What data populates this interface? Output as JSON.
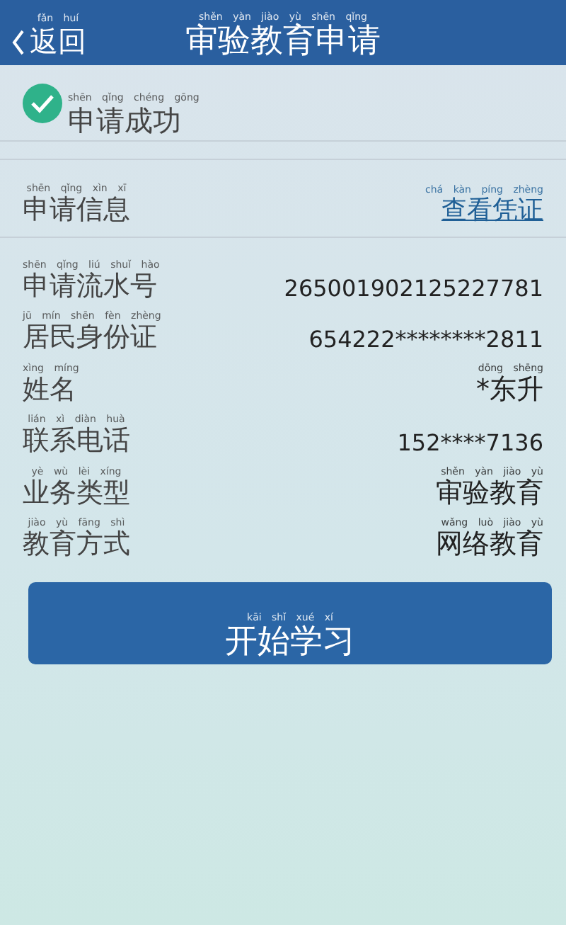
{
  "header": {
    "back": {
      "text": "返回",
      "pinyin": "fǎn huí"
    },
    "title": {
      "text": "审验教育申请",
      "pinyin": "shěn yàn jiào yù shēn qǐng"
    }
  },
  "status": {
    "text": "申请成功",
    "pinyin": "shēn qǐng chéng gōng",
    "success": true
  },
  "section": {
    "title": {
      "text": "申请信息",
      "pinyin": "shēn qǐng xìn xī"
    },
    "link": {
      "text": "查看凭证",
      "pinyin": "chá kàn píng zhèng"
    }
  },
  "rows": [
    {
      "label": {
        "text": "申请流水号",
        "pinyin": "shēn qǐng liú shuǐ hào"
      },
      "value": {
        "text": "265001902125227781"
      }
    },
    {
      "label": {
        "text": "居民身份证",
        "pinyin": "jū mín shēn fèn zhèng"
      },
      "value": {
        "text": "654222********2811"
      }
    },
    {
      "label": {
        "text": "姓名",
        "pinyin": "xìng míng"
      },
      "value": {
        "text": "*东升",
        "pinyin": "dōng shēng"
      }
    },
    {
      "label": {
        "text": "联系电话",
        "pinyin": "lián xì diàn huà"
      },
      "value": {
        "text": "152****7136"
      }
    },
    {
      "label": {
        "text": "业务类型",
        "pinyin": "yè wù lèi xíng"
      },
      "value": {
        "text": "审验教育",
        "pinyin": "shěn yàn jiào yù"
      }
    },
    {
      "label": {
        "text": "教育方式",
        "pinyin": "jiào yù fāng shì"
      },
      "value": {
        "text": "网络教育",
        "pinyin": "wǎng luò jiào yù"
      }
    }
  ],
  "button": {
    "text": "开始学习",
    "pinyin": "kāi shǐ xué xí"
  }
}
